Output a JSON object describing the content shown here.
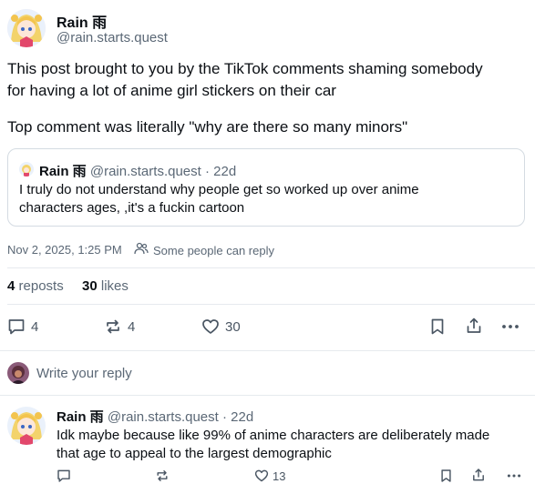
{
  "post": {
    "author_name": "Rain 雨",
    "author_handle": "@rain.starts.quest",
    "text_line1": "This post brought to you by the TikTok comments shaming somebody",
    "text_line2": "for having a lot of anime girl stickers on their car",
    "text_line3": "Top comment was literally \"why are there so many minors\"",
    "timestamp": "Nov 2, 2025, 1:25 PM",
    "reply_setting": "Some people can reply",
    "reposts_count": "4",
    "reposts_label": "reposts",
    "likes_count": "30",
    "likes_label": "likes",
    "actions": {
      "reply_count": "4",
      "repost_count": "4",
      "like_count": "30"
    }
  },
  "quote": {
    "author_name": "Rain 雨",
    "author_handle": "@rain.starts.quest",
    "age": "· 22d",
    "text_line1": "I truly do not understand why people get so worked up over anime",
    "text_line2": "characters ages, ,it's a fuckin cartoon"
  },
  "composer": {
    "placeholder": "Write your reply"
  },
  "reply": {
    "author_name": "Rain 雨",
    "author_handle": "@rain.starts.quest",
    "age": "· 22d",
    "text_line1": "Idk maybe because like 99% of anime characters are deliberately made",
    "text_line2": "that age to appeal to the largest demographic",
    "actions": {
      "like_count": "13"
    }
  },
  "colors": {
    "text": "#0b0f14",
    "muted": "#5b6876",
    "divider": "#e6eaee",
    "icon": "#4a5663"
  }
}
